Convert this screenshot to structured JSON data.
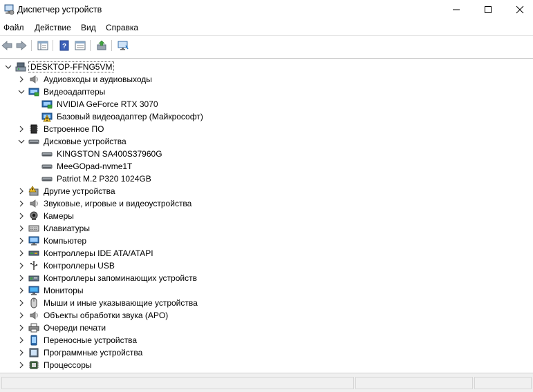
{
  "window": {
    "title": "Диспетчер устройств",
    "minimize_icon": "minimize-icon",
    "maximize_icon": "maximize-icon",
    "close_icon": "close-icon"
  },
  "menu": [
    "Файл",
    "Действие",
    "Вид",
    "Справка"
  ],
  "toolbar": {
    "buttons": [
      "back-arrow-icon",
      "forward-arrow-icon",
      "properties-icon",
      "help-icon",
      "details-view-icon",
      "update-driver-icon",
      "monitor-scan-icon"
    ]
  },
  "tree": {
    "root": "DESKTOP-FFNG5VM",
    "items": [
      {
        "label": "Аудиовходы и аудиовыходы",
        "icon": "speaker-icon",
        "expanded": false
      },
      {
        "label": "Видеоадаптеры",
        "icon": "display-adapter-icon",
        "expanded": true,
        "children": [
          {
            "label": "NVIDIA GeForce RTX 3070",
            "icon": "display-adapter-icon"
          },
          {
            "label": "Базовый видеоадаптер (Майкрософт)",
            "icon": "display-adapter-warning-icon"
          }
        ]
      },
      {
        "label": "Встроенное ПО",
        "icon": "firmware-icon",
        "expanded": false
      },
      {
        "label": "Дисковые устройства",
        "icon": "disk-drive-icon",
        "expanded": true,
        "children": [
          {
            "label": "KINGSTON SA400S37960G",
            "icon": "disk-drive-icon"
          },
          {
            "label": "MeeGOpad-nvme1T",
            "icon": "disk-drive-icon"
          },
          {
            "label": "Patriot M.2 P320 1024GB",
            "icon": "disk-drive-icon"
          }
        ]
      },
      {
        "label": "Другие устройства",
        "icon": "unknown-device-icon",
        "expanded": false
      },
      {
        "label": "Звуковые, игровые и видеоустройства",
        "icon": "sound-icon",
        "expanded": false
      },
      {
        "label": "Камеры",
        "icon": "camera-icon",
        "expanded": false
      },
      {
        "label": "Клавиатуры",
        "icon": "keyboard-icon",
        "expanded": false
      },
      {
        "label": "Компьютер",
        "icon": "computer-icon",
        "expanded": false
      },
      {
        "label": "Контроллеры IDE ATA/ATAPI",
        "icon": "ide-controller-icon",
        "expanded": false
      },
      {
        "label": "Контроллеры USB",
        "icon": "usb-icon",
        "expanded": false
      },
      {
        "label": "Контроллеры запоминающих устройств",
        "icon": "storage-controller-icon",
        "expanded": false
      },
      {
        "label": "Мониторы",
        "icon": "monitor-icon",
        "expanded": false
      },
      {
        "label": "Мыши и иные указывающие устройства",
        "icon": "mouse-icon",
        "expanded": false
      },
      {
        "label": "Объекты обработки звука (APO)",
        "icon": "audio-processing-icon",
        "expanded": false
      },
      {
        "label": "Очереди печати",
        "icon": "printer-icon",
        "expanded": false
      },
      {
        "label": "Переносные устройства",
        "icon": "portable-device-icon",
        "expanded": false
      },
      {
        "label": "Программные устройства",
        "icon": "software-device-icon",
        "expanded": false
      },
      {
        "label": "Процессоры",
        "icon": "processor-icon",
        "expanded": false
      }
    ]
  },
  "colors": {
    "accent_blue": "#1e78c8",
    "warning_yellow": "#f2c12e"
  }
}
